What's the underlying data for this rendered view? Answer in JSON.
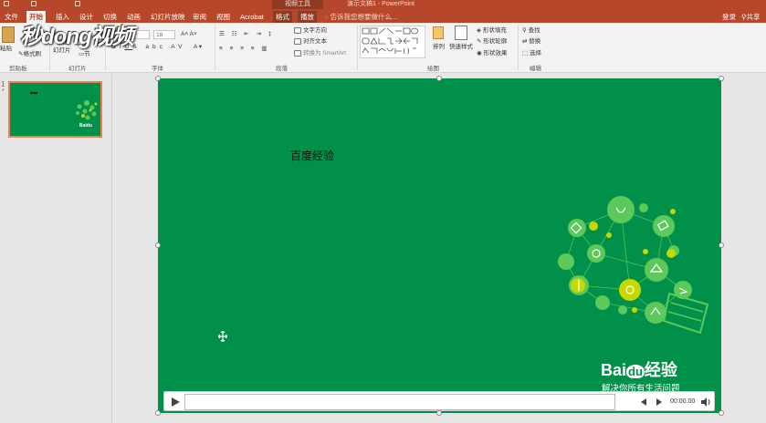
{
  "window": {
    "title": "演示文稿1 - PowerPoint",
    "context_group": "视频工具"
  },
  "tabs": [
    "文件",
    "开始",
    "插入",
    "设计",
    "切换",
    "动画",
    "幻灯片放映",
    "审阅",
    "视图",
    "Acrobat",
    "格式",
    "播放"
  ],
  "active_tab": "开始",
  "tell_me": "告诉我您想要做什么...",
  "account": {
    "login": "登录",
    "share": "共享"
  },
  "ribbon": {
    "clipboard": {
      "paste": "粘贴",
      "format_painter": "格式刷",
      "label": "剪贴板"
    },
    "slides": {
      "new_slide_line1": "新建",
      "new_slide_line2": "幻灯片",
      "section": "节",
      "label": "幻灯片"
    },
    "font": {
      "size": "18",
      "label": "字体"
    },
    "paragraph": {
      "text_direction": "文字方向",
      "align_text": "对齐文本",
      "convert_smartart": "转换为 SmartArt",
      "label": "段落"
    },
    "drawing": {
      "arrange": "排列",
      "quick_styles": "快速样式",
      "shape_fill": "形状填充",
      "shape_outline": "形状轮廓",
      "shape_effects": "形状效果",
      "label": "绘图"
    },
    "editing": {
      "find": "查找",
      "replace": "替换",
      "select": "选择",
      "label": "编辑"
    }
  },
  "watermark": "秒dong视频",
  "thumbnails": [
    {
      "number": "1",
      "star": "*"
    }
  ],
  "slide": {
    "title": "百度经验",
    "brand": "Bai 经验",
    "brand_paw": "du",
    "slogan": "解决你所有生活问题",
    "background": "#00904a"
  },
  "media": {
    "time": "00:00.00",
    "progress": 0
  },
  "colors": {
    "accent": "#b7472a",
    "slide_green": "#00904a",
    "bulb_light": "#5cc95a",
    "bulb_yellow": "#c6d800"
  }
}
